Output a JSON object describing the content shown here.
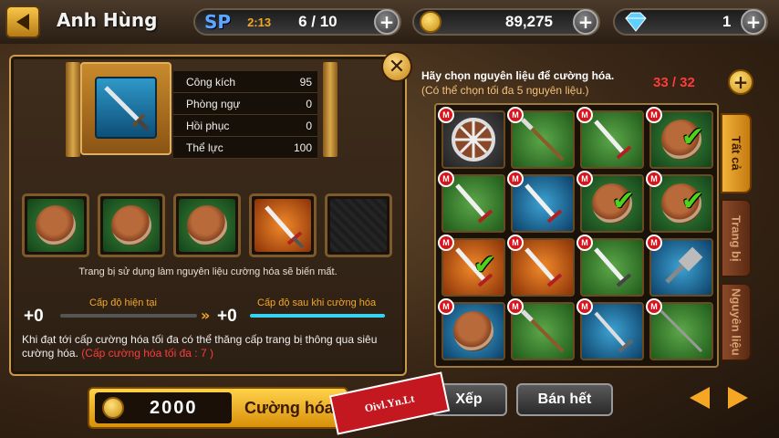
{
  "header": {
    "title": "Anh Hùng",
    "sp_label": "SP",
    "sp_timer": "2:13",
    "sp_count": "6 / 10",
    "gold": "89,275",
    "gems": "1"
  },
  "weapon_stats": [
    {
      "label": "Công kích",
      "value": "95"
    },
    {
      "label": "Phòng ngự",
      "value": "0"
    },
    {
      "label": "Hồi phục",
      "value": "0"
    },
    {
      "label": "Thể lực",
      "value": "100"
    }
  ],
  "material_notice": "Trang bị sử dụng làm nguyên liệu cường hóa sẽ biến mất.",
  "levels": {
    "current_label": "Cấp độ hiện tại",
    "after_label": "Cấp độ sau khi cường hóa",
    "current_value": "+0",
    "after_value": "+0"
  },
  "info": {
    "text": "Khi đạt tới cấp cường hóa tối đa có thể thăng cấp trang bị thông qua siêu cường hóa.",
    "max_text": "(Cấp cường hóa tối đa : 7 )"
  },
  "right": {
    "title": "Hãy chọn nguyên liệu để cường hóa.",
    "subtitle": "(Có thể chọn tối đa 5 nguyên liệu.)",
    "count": "33 / 32"
  },
  "tabs": [
    {
      "label": "Tất cả"
    },
    {
      "label": "Trang bị"
    },
    {
      "label": "Nguyên liệu"
    }
  ],
  "grid_badge": "M",
  "buttons": {
    "sort": "Xếp",
    "sell_all": "Bán hết",
    "enhance_cost": "2000",
    "enhance": "Cường hóa"
  },
  "watermark": "Oivl.Yn.Lt",
  "colors": {
    "accent": "#f5a623",
    "count_red": "#ff3b3b",
    "tab_active": "#f2b23a"
  }
}
